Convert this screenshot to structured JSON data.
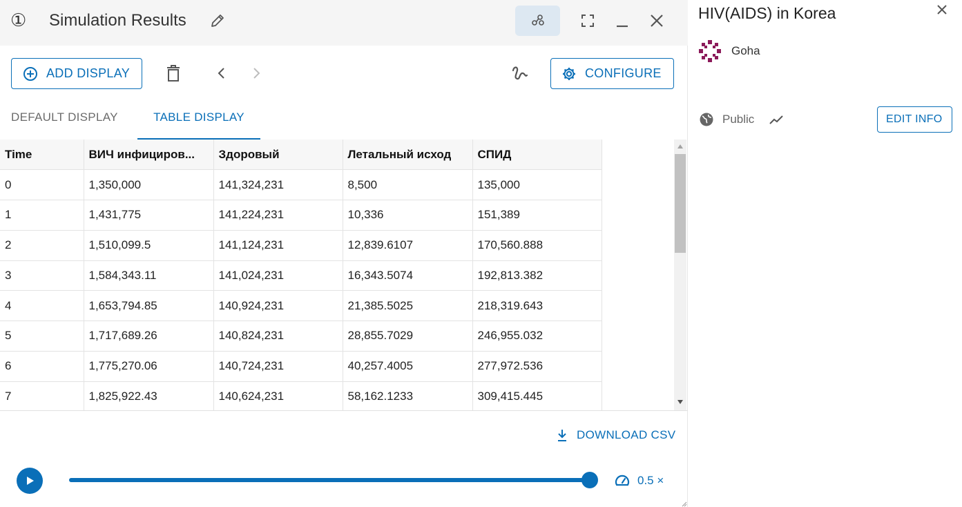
{
  "header": {
    "index_symbol": "①",
    "title": "Simulation Results"
  },
  "toolbar": {
    "add_display_label": "ADD DISPLAY",
    "configure_label": "CONFIGURE"
  },
  "tabs": [
    {
      "label": "DEFAULT DISPLAY",
      "active": false
    },
    {
      "label": "TABLE DISPLAY",
      "active": true
    }
  ],
  "table": {
    "columns": [
      "Time",
      "ВИЧ инфициров...",
      "Здоровый",
      "Летальный исход",
      "СПИД"
    ],
    "rows": [
      [
        "0",
        "1,350,000",
        "141,324,231",
        "8,500",
        "135,000"
      ],
      [
        "1",
        "1,431,775",
        "141,224,231",
        "10,336",
        "151,389"
      ],
      [
        "2",
        "1,510,099.5",
        "141,124,231",
        "12,839.6107",
        "170,560.888"
      ],
      [
        "3",
        "1,584,343.11",
        "141,024,231",
        "16,343.5074",
        "192,813.382"
      ],
      [
        "4",
        "1,653,794.85",
        "140,924,231",
        "21,385.5025",
        "218,319.643"
      ],
      [
        "5",
        "1,717,689.26",
        "140,824,231",
        "28,855.7029",
        "246,955.032"
      ],
      [
        "6",
        "1,775,270.06",
        "140,724,231",
        "40,257.4005",
        "277,972.536"
      ],
      [
        "7",
        "1,825,922.43",
        "140,624,231",
        "58,162.1233",
        "309,415.445"
      ]
    ]
  },
  "download": {
    "label": "DOWNLOAD CSV"
  },
  "playback": {
    "progress": 1.0,
    "speed_label": "0.5 ×"
  },
  "info_panel": {
    "title": "HIV(AIDS) in Korea",
    "author": "Goha",
    "visibility": "Public",
    "edit_label": "EDIT INFO"
  },
  "colors": {
    "accent": "#0a6fb8",
    "header_bg": "#f5f5f5",
    "avatar": "#8b1a5a"
  },
  "icons": {
    "edit": "pencil-icon",
    "graph": "graph-nodes-icon",
    "fullscreen": "fullscreen-icon",
    "minimize": "minimize-icon",
    "close": "close-icon",
    "add": "add-circle-icon",
    "delete": "trash-icon",
    "prev": "chevron-left-icon",
    "next": "chevron-right-icon",
    "link": "link-squiggle-icon",
    "configure": "gear-icon",
    "download": "download-icon",
    "play": "play-icon",
    "speed": "speedometer-icon",
    "visibility": "globe-icon",
    "trend": "trend-icon"
  }
}
